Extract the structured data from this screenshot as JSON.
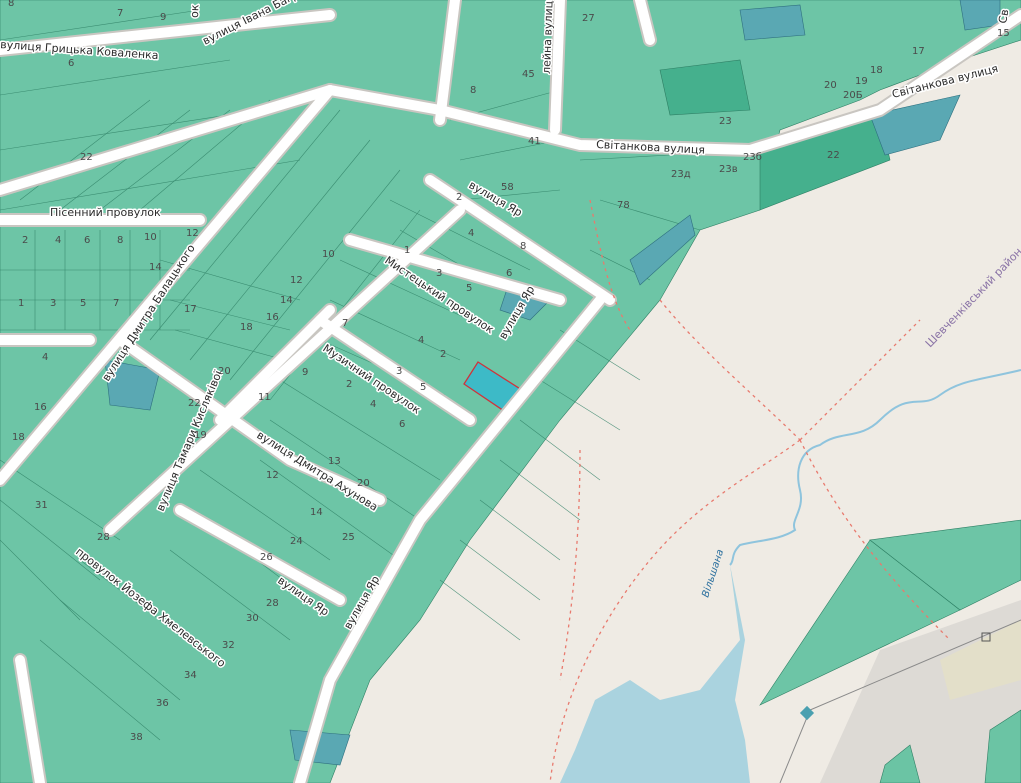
{
  "map": {
    "streets": {
      "hrytska_kovalenka": "вулиця Грицька Коваленка",
      "ivana_bahrianoho": "вулиця Івана Багр",
      "pisennyi": "Пісенний провулок",
      "dmytra_balatskoho": "вулиця Дмитра Балацького",
      "yar_top": "вулиця Яр",
      "yar_middle": "вулиця Яр",
      "yar_small": "вулиця Яр",
      "yar_bottom": "вулиця Яр",
      "mystetskyi": "Мистецький провулок",
      "muzychnyi": "Музичний провулок",
      "tamary_kysliakovoi": "вулиця Тамари Кисляківої",
      "dmytra_akhunova": "вулиця Дмитра Ахунова",
      "yuzefa_khmelevskoho": "провулок Йозефа Хмелевського",
      "svitankova_top": "Світанкова вулиця",
      "svitankova_main": "Світанкова вулиця",
      "lilova": "лейна вулиця",
      "nk_top": "ок",
      "sv_edge": "Св"
    },
    "district": "Шевченківський район",
    "water": "Вільшана",
    "house_numbers": {
      "n7a": "7",
      "n9a": "9",
      "n6": "6",
      "n27": "27",
      "n45": "45",
      "n8": "8",
      "n20": "20",
      "n19": "19",
      "n18": "18",
      "n17": "17",
      "n20b": "20Б",
      "n15": "15",
      "n23": "23",
      "n23b": "23б",
      "n23d": "23д",
      "n23v": "23в",
      "n22": "22",
      "n58": "58",
      "n41": "41",
      "n78": "78",
      "n1": "1",
      "n2": "2",
      "n4": "4",
      "n6b": "6",
      "n8b": "8",
      "n10": "10",
      "n12": "12",
      "n14": "14",
      "n1b": "1",
      "n3": "3",
      "n5": "5",
      "n7": "7",
      "n16": "16",
      "n18b": "18",
      "n20c": "20",
      "n24": "24",
      "n26": "26",
      "n28": "28",
      "n30": "30",
      "n32": "32",
      "n34": "34",
      "n36": "36",
      "n38": "38",
      "n31": "31",
      "n11": "11",
      "n13": "13",
      "n25": "25",
      "n9b": "9",
      "n3b": "3",
      "n6c": "6",
      "n4b": "4",
      "n2b": "2",
      "n5b": "5",
      "n12b": "12",
      "n14b": "14",
      "n17b": "17",
      "n22b": "22",
      "n19b": "19",
      "n4c": "4",
      "n1c": "1",
      "n8c": "8",
      "n8d": "8",
      "n6d": "6",
      "n2c": "2",
      "n10b": "10",
      "n12c": "12",
      "n14c": "14",
      "n16b": "16",
      "n22c": "22"
    },
    "colors": {
      "parcel": "#5ec19f",
      "parcel_dark": "#45b08d",
      "selected_parcel": "#3dbac7",
      "selected_outline": "#d0323a",
      "water": "#aad3df",
      "background": "#efebe4",
      "trail": "#e87a6e"
    }
  }
}
